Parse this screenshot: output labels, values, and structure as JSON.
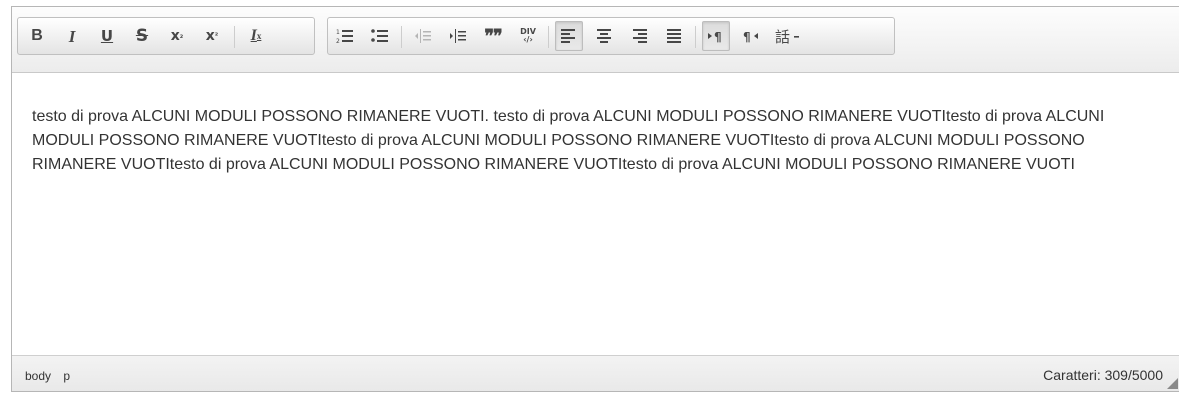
{
  "toolbar": {
    "bold": "B",
    "italic": "I",
    "underline": "U",
    "strike": "S",
    "subscript_base": "x",
    "subscript_mark": "₂",
    "superscript_base": "x",
    "superscript_mark": "²",
    "remove_format_base": "I",
    "remove_format_mark": "x",
    "blockquote": "❞❞",
    "div_top": "DIV",
    "div_bottom": "‹/›",
    "rtl_glyph": "¶",
    "language_glyph": "話"
  },
  "icons": {
    "numbered_list": "numbered-list-icon",
    "bulleted_list": "bulleted-list-icon",
    "outdent": "outdent-icon",
    "indent": "indent-icon",
    "align_left": "align-left-icon",
    "align_center": "align-center-icon",
    "align_right": "align-right-icon",
    "justify": "justify-icon",
    "ltr": "text-direction-ltr-icon",
    "rtl": "text-direction-rtl-icon",
    "language": "language-icon"
  },
  "content": {
    "text": "testo di prova ALCUNI MODULI POSSONO RIMANERE VUOTI. testo di prova ALCUNI MODULI POSSONO RIMANERE VUOTItesto di prova ALCUNI MODULI POSSONO RIMANERE VUOTItesto di prova ALCUNI MODULI POSSONO RIMANERE VUOTItesto di prova ALCUNI MODULI POSSONO RIMANERE VUOTItesto di prova ALCUNI MODULI POSSONO RIMANERE VUOTItesto di prova ALCUNI MODULI POSSONO RIMANERE VUOTI"
  },
  "status": {
    "path": [
      "body",
      "p"
    ],
    "char_count": "Caratteri: 309/5000"
  },
  "colors": {
    "toolbar_bg": "#ececec",
    "border": "#b6b6b6",
    "text": "#333333",
    "icon": "#474747"
  }
}
